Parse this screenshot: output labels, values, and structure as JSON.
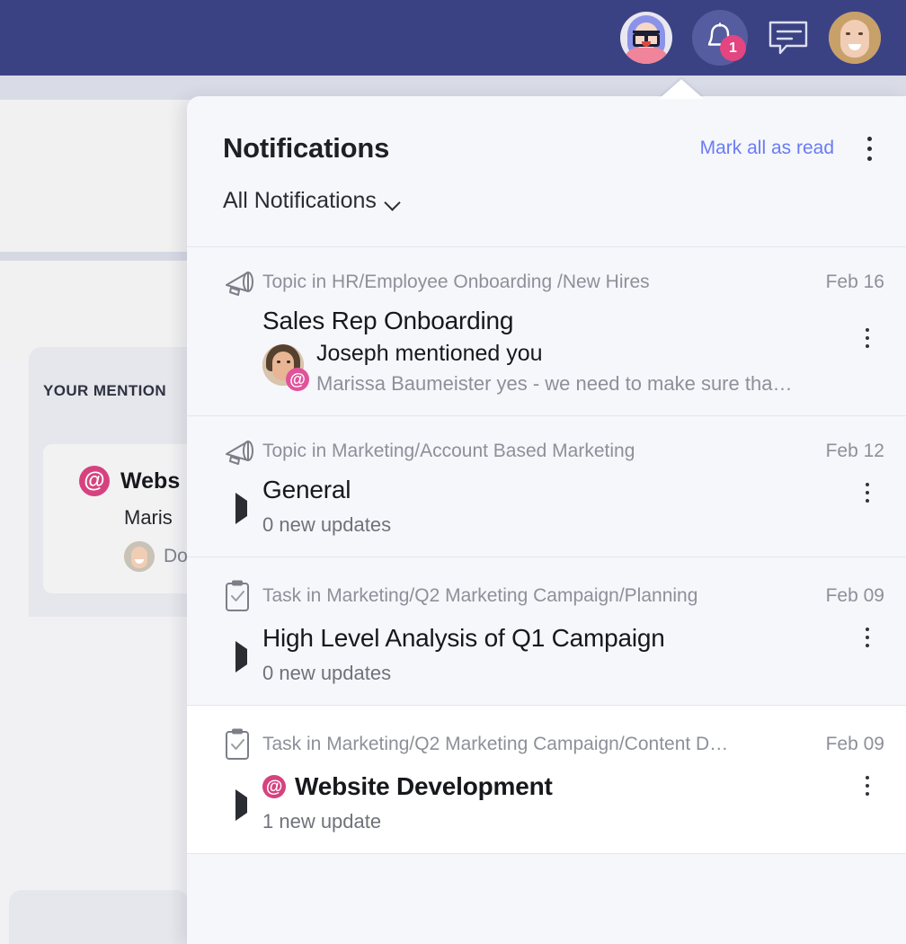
{
  "topbar": {
    "accent_color": "#3b4283",
    "bell_badge_count": "1",
    "icons": [
      "teammate-avatar",
      "notifications-bell",
      "chat-message",
      "user-avatar"
    ]
  },
  "background": {
    "section_title": "YOUR MENTION",
    "mention_card": {
      "title": "Webs",
      "subtitle": "Maris",
      "footer_text": "Do",
      "at_symbol": "@"
    }
  },
  "popover": {
    "title": "Notifications",
    "mark_all_label": "Mark all as read",
    "more_menu_icon": "kebab-menu-icon",
    "filter_label": "All Notifications",
    "accent_link_color": "#6a7bf4",
    "mention_color": "#d6427f",
    "notifications": [
      {
        "icon": "megaphone-icon",
        "context": "Topic in HR/Employee Onboarding /New Hires",
        "date": "Feb 16",
        "title": "Sales Rep Onboarding",
        "bold_title": false,
        "has_expander": false,
        "has_mention_badge": false,
        "mention": {
          "avatar": "joseph-avatar",
          "at_symbol": "@",
          "actor_line": "Joseph mentioned you",
          "preview": "Marissa Baumeister yes - we need to make sure tha…"
        },
        "background": "#f5f7fb"
      },
      {
        "icon": "megaphone-icon",
        "context": "Topic in Marketing/Account Based Marketing",
        "date": "Feb 12",
        "title": "General",
        "bold_title": false,
        "has_expander": true,
        "has_mention_badge": false,
        "subtitle": "0 new updates",
        "background": "#f5f7fb"
      },
      {
        "icon": "task-clipboard-icon",
        "context": "Task in Marketing/Q2 Marketing Campaign/Planning",
        "date": "Feb 09",
        "title": "High Level Analysis of Q1 Campaign",
        "bold_title": false,
        "has_expander": true,
        "has_mention_badge": false,
        "subtitle": "0 new updates",
        "background": "#f5f7fb"
      },
      {
        "icon": "task-clipboard-icon",
        "context": "Task in Marketing/Q2 Marketing Campaign/Content D…",
        "date": "Feb 09",
        "title": "Website Development",
        "bold_title": true,
        "has_expander": true,
        "has_mention_badge": true,
        "at_symbol": "@",
        "subtitle": "1 new update",
        "background": "#ffffff"
      }
    ]
  }
}
